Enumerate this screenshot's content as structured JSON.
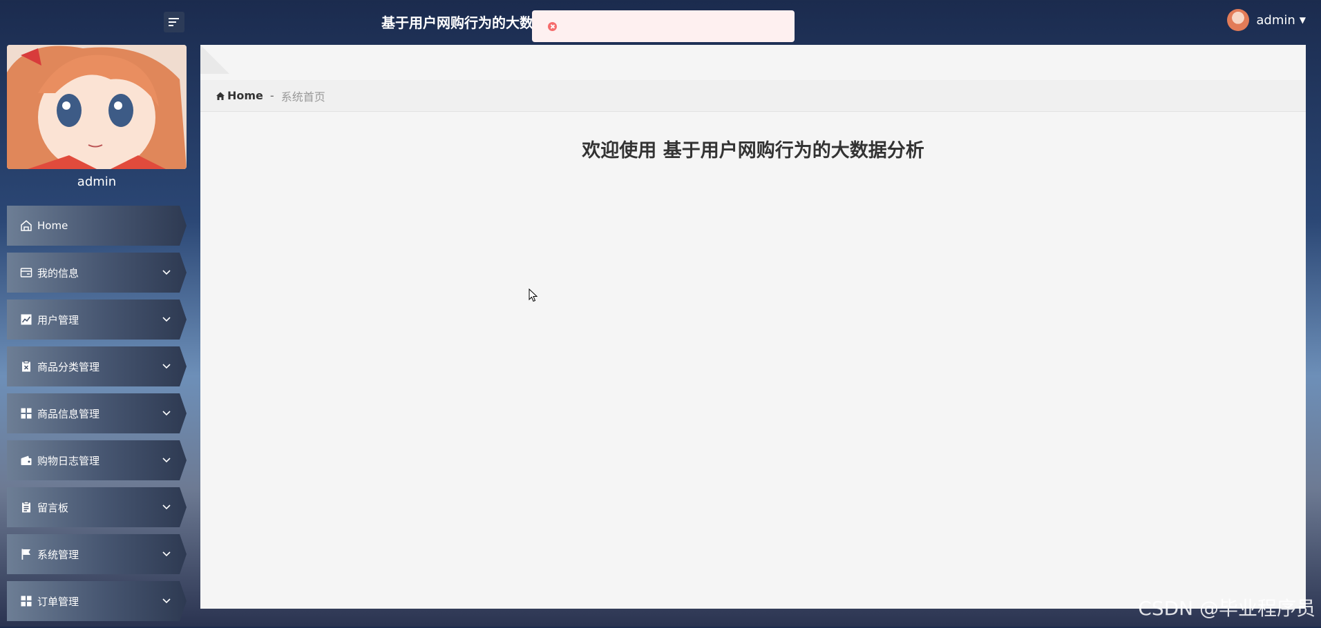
{
  "header": {
    "site_title": "基于用户网购行为的大数",
    "user_name": "admin",
    "caret": "▼"
  },
  "toasts": [
    {
      "icon": "error-circle-icon",
      "message": ""
    },
    {
      "icon": "error-circle-icon",
      "message": ""
    }
  ],
  "sidebar": {
    "profile_name": "admin",
    "items": [
      {
        "label": "Home",
        "icon": "home-icon",
        "has_submenu": false
      },
      {
        "label": "我的信息",
        "icon": "card-icon",
        "has_submenu": true
      },
      {
        "label": "用户管理",
        "icon": "chart-icon",
        "has_submenu": true
      },
      {
        "label": "商品分类管理",
        "icon": "clipboard-x-icon",
        "has_submenu": true
      },
      {
        "label": "商品信息管理",
        "icon": "grid-icon",
        "has_submenu": true
      },
      {
        "label": "购物日志管理",
        "icon": "wallet-icon",
        "has_submenu": true
      },
      {
        "label": "留言板",
        "icon": "clipboard-icon",
        "has_submenu": true
      },
      {
        "label": "系统管理",
        "icon": "flag-icon",
        "has_submenu": true
      },
      {
        "label": "订单管理",
        "icon": "grid-icon",
        "has_submenu": true
      }
    ]
  },
  "breadcrumb": {
    "home": "Home",
    "separator": "-",
    "current": "系统首页"
  },
  "main": {
    "welcome": "欢迎使用 基于用户网购行为的大数据分析"
  },
  "watermark": "CSDN @毕业程序员"
}
